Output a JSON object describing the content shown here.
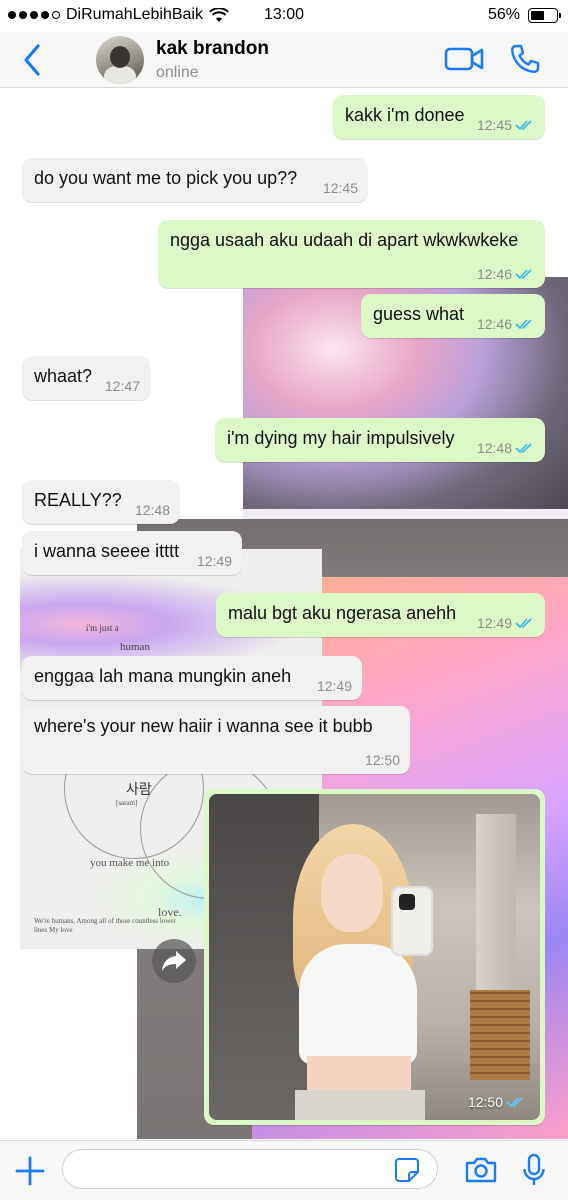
{
  "status_bar": {
    "carrier": "DiRumahLebihBaik",
    "time": "13:00",
    "battery": "56%",
    "battery_level": 0.56
  },
  "header": {
    "contact_name": "kak brandon",
    "contact_status": "online"
  },
  "background_card": {
    "line1": "i'm just a",
    "line2": "human",
    "line3": "사람",
    "line4": "[saram]",
    "line5": "you make me into",
    "line6": "love.",
    "line7": "We're humans, Among all of those countless lower lines My love"
  },
  "messages": [
    {
      "side": "out",
      "text": "kakk i'm donee",
      "time": "12:45",
      "read": true
    },
    {
      "side": "in",
      "text": "do you want me to pick you up??",
      "time": "12:45"
    },
    {
      "side": "out",
      "text": "ngga usaah aku udaah di apart wkwkwkeke",
      "time": "12:46",
      "read": true
    },
    {
      "side": "out",
      "text": "guess what",
      "time": "12:46",
      "read": true
    },
    {
      "side": "in",
      "text": "whaat?",
      "time": "12:47"
    },
    {
      "side": "out",
      "text": "i'm dying my hair impulsively",
      "time": "12:48",
      "read": true
    },
    {
      "side": "in",
      "text": "REALLY??",
      "time": "12:48"
    },
    {
      "side": "in",
      "text": "i wanna seeee itttt",
      "time": "12:49"
    },
    {
      "side": "out",
      "text": "malu bgt aku ngerasa anehh",
      "time": "12:49",
      "read": true
    },
    {
      "side": "in",
      "text": "enggaa lah mana mungkin aneh",
      "time": "12:49"
    },
    {
      "side": "in",
      "text": "where's your new haiir i wanna see it bubb",
      "time": "12:50"
    }
  ],
  "photo_message": {
    "time": "12:50",
    "read": true
  },
  "input": {
    "value": "",
    "placeholder": ""
  },
  "colors": {
    "accent": "#1a7cf5",
    "outgoing_bubble": "#dcf8c6",
    "incoming_bubble": "#f1f1f1",
    "read_check": "#34b7f1"
  },
  "icons": [
    "back-chevron-icon",
    "video-call-icon",
    "phone-icon",
    "forward-icon",
    "plus-icon",
    "sticker-icon",
    "camera-icon",
    "microphone-icon",
    "double-check-icon"
  ]
}
